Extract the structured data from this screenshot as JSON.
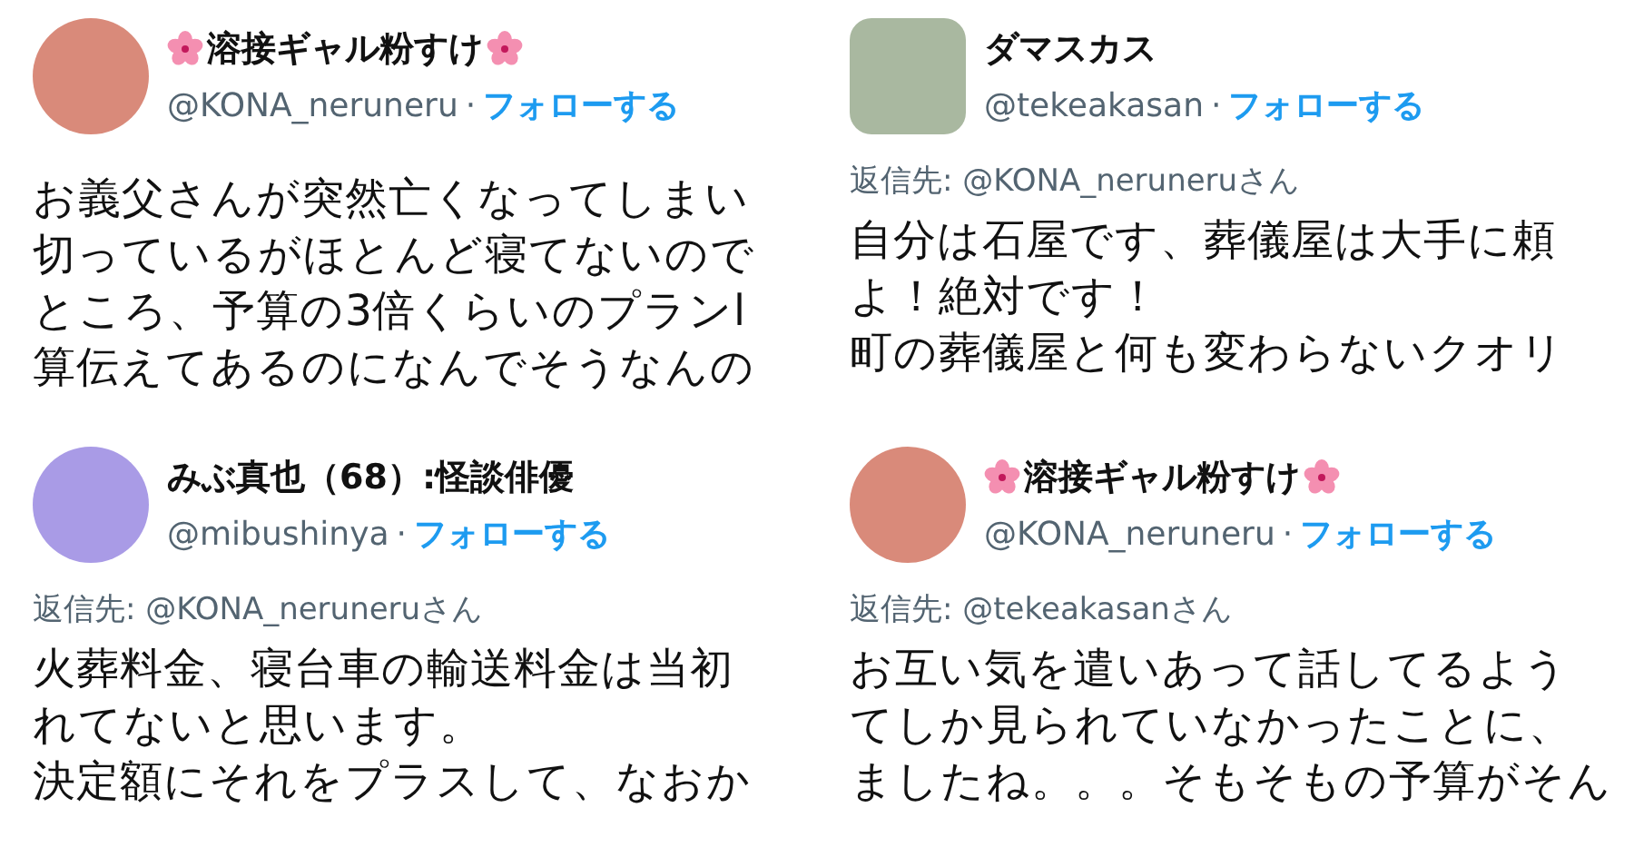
{
  "tweets": [
    {
      "avatar": {
        "kind": "circle",
        "color": "#d98a7a"
      },
      "name": "溶接ギャル粉すけ",
      "name_flowers": true,
      "handle": "@KONA_neruneru",
      "separator": "·",
      "follow": "フォローする",
      "body": [
        "お義父さんが突然亡くなってしまい",
        "切っているがほとんど寝てないので",
        "ところ、予算の3倍くらいのプランl",
        "算伝えてあるのになんでそうなんの"
      ]
    },
    {
      "avatar": {
        "kind": "rounded",
        "color": "#a9b8a0"
      },
      "name": "ダマスカス",
      "name_flowers": false,
      "handle": "@tekeakasan",
      "separator": "·",
      "follow": "フォローする",
      "reply_to": "返信先: @KONA_neruneruさん",
      "body": [
        "自分は石屋です、葬儀屋は大手に頼",
        "よ！絶対です！",
        "町の葬儀屋と何も変わらないクオリ"
      ]
    },
    {
      "avatar": {
        "kind": "circle",
        "color": "#a99be6"
      },
      "name": "みぶ真也（68）:怪談俳優",
      "name_flowers": false,
      "handle": "@mibushinya",
      "separator": "·",
      "follow": "フォローする",
      "reply_to": "返信先: @KONA_neruneruさん",
      "body": [
        "火葬料金、寝台車の輸送料金は当初",
        "れてないと思います。",
        "決定額にそれをプラスして、なおか"
      ]
    },
    {
      "avatar": {
        "kind": "circle",
        "color": "#d98a7a"
      },
      "name": "溶接ギャル粉すけ",
      "name_flowers": true,
      "handle": "@KONA_neruneru",
      "separator": "·",
      "follow": "フォローする",
      "reply_to": "返信先: @tekeakasanさん",
      "body": [
        "お互い気を遣いあって話してるよう",
        "てしか見られていなかったことに、",
        "ましたね。。。そもそもの予算がそん"
      ]
    }
  ]
}
